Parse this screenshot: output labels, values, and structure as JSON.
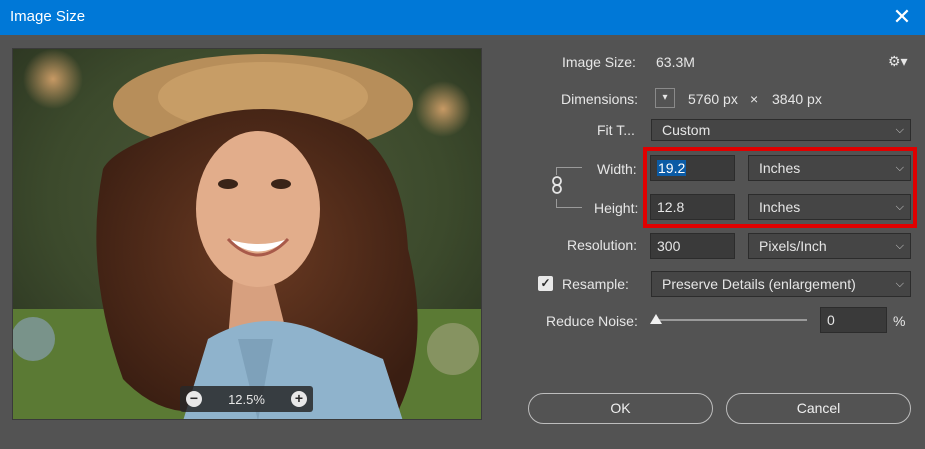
{
  "window": {
    "title": "Image Size",
    "close_glyph": "✕"
  },
  "preview": {
    "zoom_value": "12.5%",
    "zoom_out_glyph": "−",
    "zoom_in_glyph": "+"
  },
  "image_size": {
    "label": "Image Size:",
    "value": "63.3M"
  },
  "settings": {
    "icon": "gear-icon",
    "glyph": "⚙▾"
  },
  "dimensions": {
    "label": "Dimensions:",
    "width_px": "5760 px",
    "times": "×",
    "height_px": "3840 px"
  },
  "fit_to": {
    "label": "Fit T...",
    "value": "Custom"
  },
  "width": {
    "label": "Width:",
    "value": "19.2",
    "unit": "Inches"
  },
  "height": {
    "label": "Height:",
    "value": "12.8",
    "unit": "Inches"
  },
  "resolution": {
    "label": "Resolution:",
    "value": "300",
    "unit": "Pixels/Inch"
  },
  "resample": {
    "label": "Resample:",
    "checked": true,
    "value": "Preserve Details (enlargement)"
  },
  "reduce_noise": {
    "label": "Reduce Noise:",
    "value": "0",
    "unit": "%",
    "level": 0
  },
  "buttons": {
    "ok": "OK",
    "cancel": "Cancel"
  },
  "colors": {
    "titlebar": "#0078d7",
    "panel": "#535353",
    "highlight": "#e00000"
  }
}
